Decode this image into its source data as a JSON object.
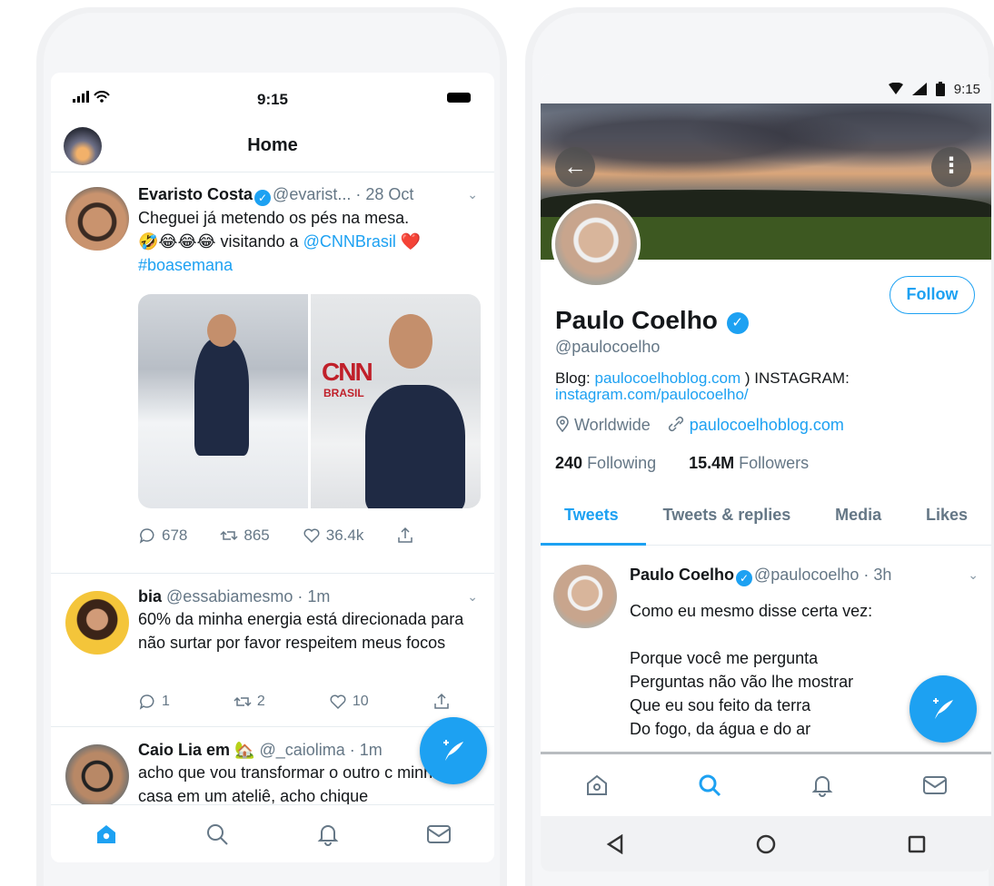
{
  "left": {
    "status": {
      "signal": "•••• ≡",
      "time": "9:15"
    },
    "header": {
      "title": "Home"
    },
    "tweets": [
      {
        "name": "Evaristo Costa",
        "handle": "@evarist...",
        "time": "· 28 Oct",
        "text_line1": "Cheguei já metendo os pés na mesa.",
        "text_emoji": "🤣😂😂😂",
        "text_mid": " visitando a ",
        "mention": "@CNNBrasil",
        "heart": " ❤️",
        "hashtag": "#boasemana",
        "replies": "678",
        "retweets": "865",
        "likes": "36.4k"
      },
      {
        "name": "bia",
        "handle": "@essabiamesmo",
        "time": "· 1m",
        "text": "60% da minha energia está direcionada para não surtar por favor respeitem meus focos",
        "replies": "1",
        "retweets": "2",
        "likes": "10"
      },
      {
        "name": "Caio Lia em 🏡",
        "handle": "@_caiolima",
        "time": "· 1m",
        "text": "acho que vou transformar o outro c minha casa em um ateliê, acho chique"
      }
    ],
    "tabbar": [
      "home-icon",
      "search-icon",
      "notifications-icon",
      "messages-icon"
    ],
    "compose": "compose-icon"
  },
  "right": {
    "status": {
      "time": "9:15"
    },
    "profile": {
      "name": "Paulo Coelho",
      "handle": "@paulocoelho",
      "follow_label": "Follow",
      "bio_prefix": "Blog: ",
      "bio_link1": "paulocoelhoblog.com",
      "bio_mid": " ) INSTAGRAM:",
      "bio_link2": "instagram.com/paulocoelho/",
      "location": "Worldwide",
      "website": "paulocoelhoblog.com",
      "following_count": "240",
      "following_label": "Following",
      "followers_count": "15.4M",
      "followers_label": "Followers"
    },
    "tabs": [
      "Tweets",
      "Tweets & replies",
      "Media",
      "Likes"
    ],
    "tweet": {
      "name": "Paulo Coelho",
      "handle": "@paulocoelho",
      "time": "· 3h",
      "line1": "Como eu mesmo disse certa vez:",
      "line2": "Porque você me pergunta",
      "line3": "Perguntas não vão lhe mostrar",
      "line4": "Que eu sou feito da terra",
      "line5": "Do fogo, da água e do ar"
    }
  },
  "colors": {
    "accent": "#1da1f2",
    "text": "#14171a",
    "muted": "#657786"
  }
}
